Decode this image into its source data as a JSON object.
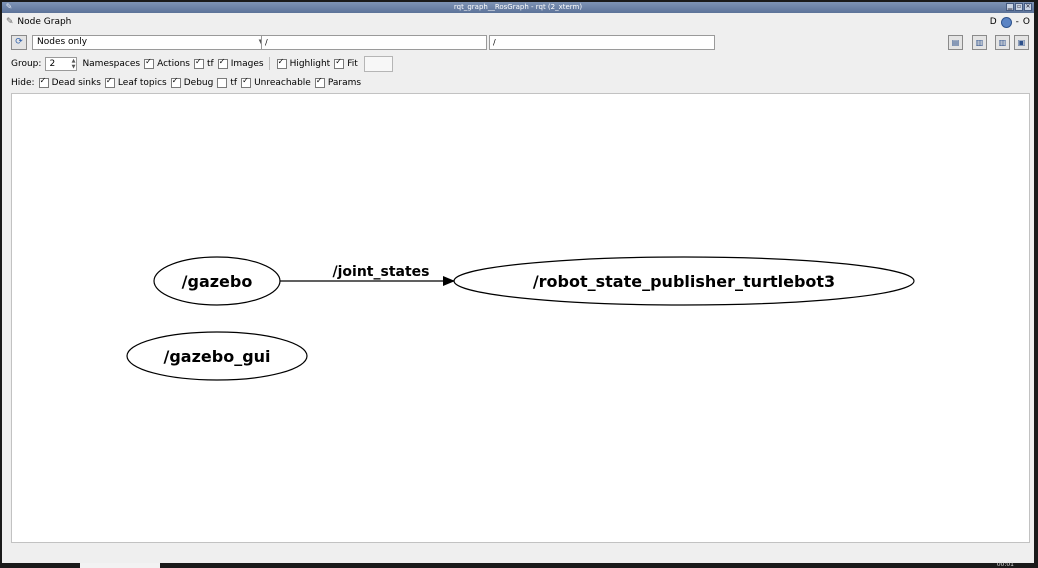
{
  "window": {
    "title": "rqt_graph__RosGraph - rqt (2_xterm)",
    "buttons": [
      "▁",
      "▫",
      "✕"
    ]
  },
  "plugin": {
    "title": "Node Graph",
    "controls": {
      "d_label": "D",
      "dash_label": "-",
      "o_label": "O"
    }
  },
  "toolbar": {
    "mode_selected": "Nodes only",
    "node_filter": "/",
    "topic_filter": "/"
  },
  "options": {
    "group_label": "Group:",
    "group_value": "2",
    "namespaces_label": "Namespaces",
    "namespaces_checked": true,
    "actions_label": "Actions",
    "actions_checked": true,
    "tf_label": "tf",
    "tf_checked": true,
    "images_label": "Images",
    "images_checked": true,
    "highlight_label": "Highlight",
    "highlight_checked": true,
    "fit_label": "Fit",
    "fit_checked": true
  },
  "hide": {
    "label": "Hide:",
    "items": [
      {
        "label": "Dead sinks",
        "checked": true
      },
      {
        "label": "Leaf topics",
        "checked": true
      },
      {
        "label": "Debug",
        "checked": true
      },
      {
        "label": "tf",
        "checked": false
      },
      {
        "label": "Unreachable",
        "checked": true
      },
      {
        "label": "Params",
        "checked": true
      }
    ]
  },
  "graph": {
    "nodes": {
      "gazebo": "/gazebo",
      "robot_state_publisher": "/robot_state_publisher_turtlebot3",
      "gazebo_gui": "/gazebo_gui"
    },
    "edges": [
      {
        "from": "/gazebo",
        "to": "/robot_state_publisher_turtlebot3",
        "label": "/joint_states"
      }
    ]
  },
  "taskbar": {
    "clock": "00:01"
  },
  "icons": {
    "app": "rqt-app-icon",
    "refresh": "refresh-icon",
    "load": "load-dot-icon",
    "save_dot": "save-dot-icon",
    "save_svg": "save-svg-icon",
    "save_image": "save-image-icon",
    "help": "help-icon"
  }
}
